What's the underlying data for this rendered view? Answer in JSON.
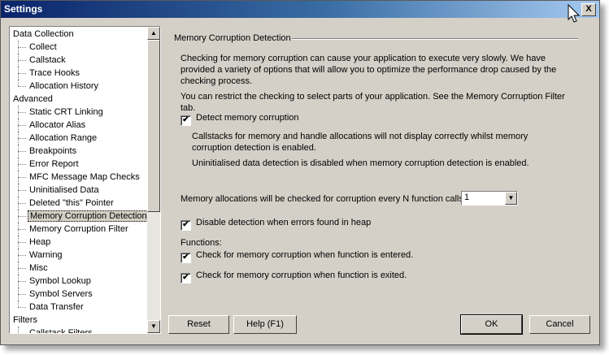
{
  "window": {
    "title": "Settings",
    "close_glyph": "X"
  },
  "tree": {
    "items": [
      {
        "label": "Data Collection",
        "child": false
      },
      {
        "label": "Collect",
        "child": true
      },
      {
        "label": "Callstack",
        "child": true
      },
      {
        "label": "Trace Hooks",
        "child": true
      },
      {
        "label": "Allocation History",
        "child": true,
        "last": true
      },
      {
        "label": "Advanced",
        "child": false
      },
      {
        "label": "Static CRT Linking",
        "child": true
      },
      {
        "label": "Allocator Alias",
        "child": true
      },
      {
        "label": "Allocation Range",
        "child": true
      },
      {
        "label": "Breakpoints",
        "child": true
      },
      {
        "label": "Error Report",
        "child": true
      },
      {
        "label": "MFC Message Map Checks",
        "child": true
      },
      {
        "label": "Uninitialised Data",
        "child": true
      },
      {
        "label": "Deleted \"this\" Pointer",
        "child": true
      },
      {
        "label": "Memory Corruption Detection",
        "child": true,
        "selected": true
      },
      {
        "label": "Memory Corruption Filter",
        "child": true
      },
      {
        "label": "Heap",
        "child": true
      },
      {
        "label": "Warning",
        "child": true
      },
      {
        "label": "Misc",
        "child": true
      },
      {
        "label": "Symbol Lookup",
        "child": true
      },
      {
        "label": "Symbol Servers",
        "child": true
      },
      {
        "label": "Data Transfer",
        "child": true,
        "last": true
      },
      {
        "label": "Filters",
        "child": false
      },
      {
        "label": "Callstack Filters",
        "child": true
      }
    ]
  },
  "panel": {
    "group_title": "Memory Corruption Detection",
    "intro": "Checking for memory corruption can cause your application to execute very slowly. We have provided a variety of options that will allow you to optimize the performance drop caused by the checking process.",
    "restrict": "You can restrict the checking to select parts of your application. See the Memory Corruption Filter tab.",
    "detect_label": "Detect memory corruption",
    "detect_checked": true,
    "note1": "Callstacks for memory and handle allocations will not display correctly whilst memory corruption detection is enabled.",
    "note2": "Uninitialised data detection is disabled when memory corruption detection is enabled.",
    "interval_label": "Memory allocations will be checked for corruption every N function calls.",
    "interval_value": "1",
    "disable_label": "Disable detection when errors found in heap",
    "disable_checked": true,
    "functions_label": "Functions:",
    "entered_label": "Check for memory corruption when function is entered.",
    "entered_checked": true,
    "exited_label": "Check for memory corruption when function is exited.",
    "exited_checked": true
  },
  "buttons": {
    "reset": "Reset",
    "help": "Help (F1)",
    "ok": "OK",
    "cancel": "Cancel"
  },
  "glyphs": {
    "check": "✔",
    "up": "▲",
    "down": "▼"
  }
}
